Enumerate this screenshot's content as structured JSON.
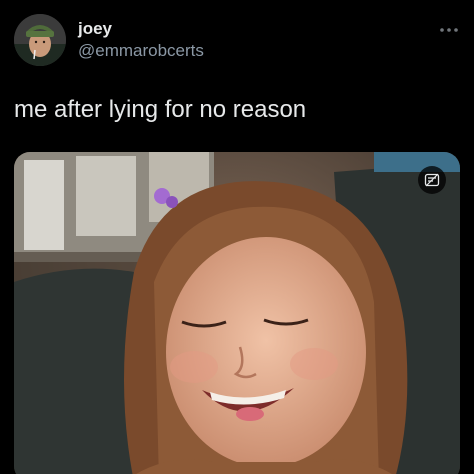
{
  "user": {
    "display_name": "joey",
    "handle": "@emmarobcerts",
    "avatar": "avatar-photo"
  },
  "tweet": {
    "text": "me after lying for no reason"
  },
  "media": {
    "type": "image",
    "description_icon": "image-description-icon"
  },
  "icons": {
    "more": "more-options-icon"
  },
  "colors": {
    "background": "#000000",
    "primary_text": "#e7e9ea",
    "secondary_text": "#8b98a5"
  }
}
